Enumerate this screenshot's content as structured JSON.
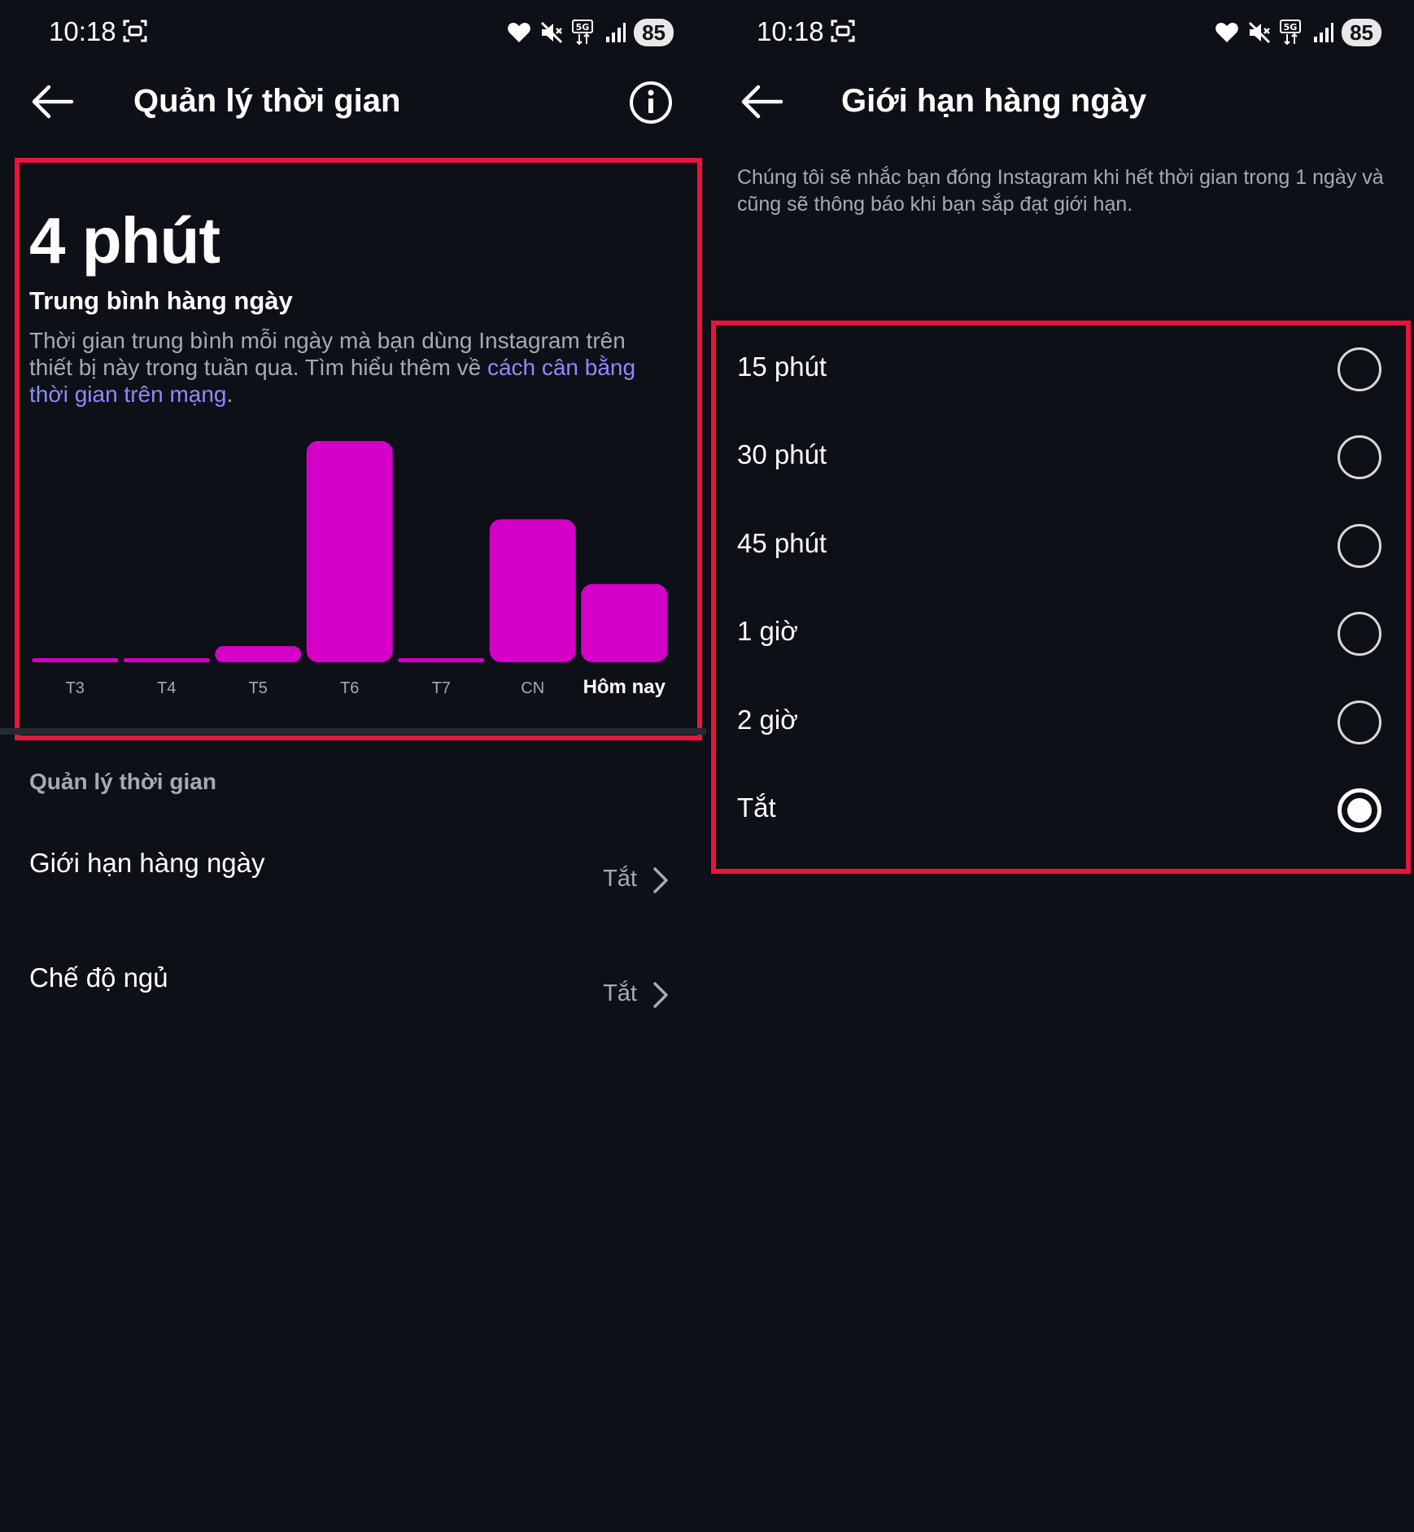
{
  "status_bar": {
    "time": "10:18",
    "battery": "85",
    "network": "5G"
  },
  "left": {
    "title": "Quản lý thời gian",
    "summary": {
      "value": "4 phút",
      "subtitle": "Trung bình hàng ngày",
      "description": "Thời gian trung bình mỗi ngày mà bạn dùng Instagram trên thiết bị này trong tuần qua. Tìm hiểu thêm về ",
      "link_text": "cách cân bằng thời gian trên mạng",
      "description_end": "."
    },
    "section_header": "Quản lý thời gian",
    "settings": [
      {
        "label": "Giới hạn hàng ngày",
        "value": "Tắt"
      },
      {
        "label": "Chế độ ngủ",
        "value": "Tắt"
      }
    ]
  },
  "chart_data": {
    "type": "bar",
    "categories": [
      "T3",
      "T4",
      "T5",
      "T6",
      "T7",
      "CN",
      "Hôm nay"
    ],
    "values": [
      0,
      0,
      0.6,
      8.2,
      0,
      5.3,
      2.9
    ],
    "highlighted_category": "Hôm nay",
    "color": "#d400c8",
    "title": "",
    "xlabel": "",
    "ylabel": ""
  },
  "right": {
    "title": "Giới hạn hàng ngày",
    "intro": "Chúng tôi sẽ nhắc bạn đóng Instagram khi hết thời gian trong 1 ngày và cũng sẽ thông báo khi bạn sắp đạt giới hạn.",
    "options": [
      {
        "label": "15 phút",
        "selected": false
      },
      {
        "label": "30 phút",
        "selected": false
      },
      {
        "label": "45 phút",
        "selected": false
      },
      {
        "label": "1 giờ",
        "selected": false
      },
      {
        "label": "2 giờ",
        "selected": false
      },
      {
        "label": "Tắt",
        "selected": true
      }
    ]
  },
  "colors": {
    "background": "#0d1016",
    "highlight": "#e8143c",
    "accent_bar": "#d400c8",
    "link": "#8a8cff",
    "muted_text": "#a7aab2"
  },
  "icons": [
    "back-arrow-icon",
    "info-icon",
    "chevron-right-icon",
    "heart-icon",
    "mute-icon",
    "signal-icon",
    "screenshot-icon"
  ]
}
